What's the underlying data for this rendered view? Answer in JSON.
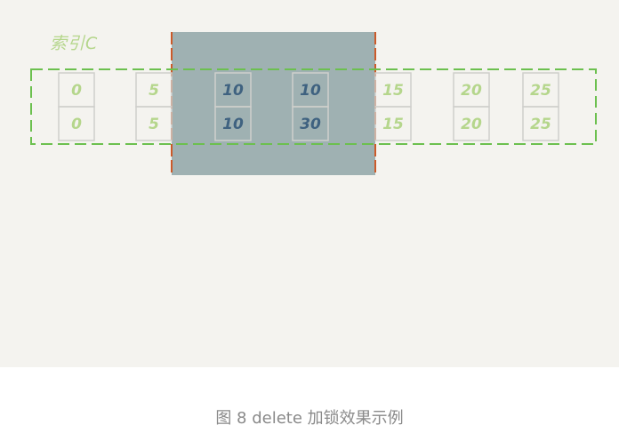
{
  "diagram": {
    "index_label": "索引C",
    "colors": {
      "background": "#f4f3ef",
      "lock_region": "#9fb1b2",
      "gap_boundary": "#cc5a2a",
      "dashed_outline": "#6cc04f",
      "value_text_light": "#b5d68c",
      "value_text_dark": "#3f6280",
      "cell_border": "#cfcfcc"
    },
    "records": [
      {
        "top": "0",
        "bottom": "0",
        "locked": false
      },
      {
        "top": "5",
        "bottom": "5",
        "locked": false
      },
      {
        "top": "10",
        "bottom": "10",
        "locked": true
      },
      {
        "top": "10",
        "bottom": "30",
        "locked": true
      },
      {
        "top": "15",
        "bottom": "15",
        "locked": false
      },
      {
        "top": "20",
        "bottom": "20",
        "locked": false
      },
      {
        "top": "25",
        "bottom": "25",
        "locked": false
      }
    ]
  },
  "caption": "图 8 delete 加锁效果示例"
}
